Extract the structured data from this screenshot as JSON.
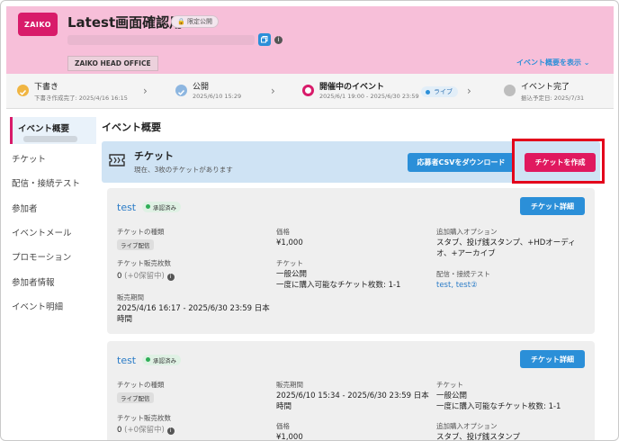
{
  "header": {
    "logo_text": "ZAIKO",
    "title": "Latest画面確認用",
    "limited_badge": "🔒 限定公開",
    "copy_icon": "copy-icon",
    "org_tag": "ZAIKO HEAD OFFICE",
    "show_summary": "イベント概要を表示 ⌄"
  },
  "steps": [
    {
      "label": "下書き",
      "sub": "下書き作成完了: 2025/4/16 16:15",
      "state": "done",
      "color": "#f0b542"
    },
    {
      "label": "公開",
      "sub": "2025/6/10 15:29",
      "state": "done",
      "color": "#8db6e0"
    },
    {
      "label": "開催中のイベント",
      "sub": "2025/6/1 19:00 - 2025/6/30 23:59",
      "state": "current",
      "color": "#d81b6a"
    },
    {
      "label": "イベント完了",
      "sub": "振込予定日: 2025/7/31",
      "state": "pending",
      "color": "#bdbdbd"
    }
  ],
  "live_badge": "ライブ",
  "sidebar": {
    "items": [
      "イベント概要",
      "チケット",
      "配信・接続テスト",
      "参加者",
      "イベントメール",
      "プロモーション",
      "参加者情報",
      "イベント明細"
    ]
  },
  "main": {
    "title": "イベント概要",
    "ticket_section": {
      "title": "チケット",
      "subtitle": "現在、3枚のチケットがあります",
      "download_button": "応募者CSVをダウンロード",
      "create_button": "チケットを作成"
    },
    "cards": [
      {
        "name": "test",
        "status": "承認済み",
        "detail_button": "チケット詳細",
        "type_label": "チケットの種類",
        "type_value": "ライブ配信",
        "sold_label": "チケット販売枚数",
        "sold_value": "0",
        "sold_hold": "(+0保留中)",
        "period_label": "販売期間",
        "period_value_1": "2025/4/16 16:17 - 2025/6/30 23:59 日本",
        "period_value_2": "時間",
        "price_label": "価格",
        "price_value": "¥1,000",
        "ticket_label": "チケット",
        "ticket_value_1": "一般公開",
        "ticket_value_2": "一度に購入可能なチケット枚数: 1-1",
        "addon_label": "追加購入オプション",
        "addon_value_1": "スタブ、投げ銭スタンプ、+HDオーディ",
        "addon_value_2": "オ、+アーカイブ",
        "stream_label": "配信・接続テスト",
        "stream_value": "test, test②"
      },
      {
        "name": "test",
        "status": "承認済み",
        "detail_button": "チケット詳細",
        "type_label": "チケットの種類",
        "type_value": "ライブ配信",
        "sold_label": "チケット販売枚数",
        "sold_value": "0",
        "sold_hold": "(+0保留中)",
        "period_label": "販売期間",
        "period_value_1": "2025/6/10 15:34 - 2025/6/30 23:59 日本",
        "period_value_2": "時間",
        "price_label": "価格",
        "price_value": "¥1,000",
        "ticket_label": "チケット",
        "ticket_value_1": "一般公開",
        "ticket_value_2": "一度に購入可能なチケット枚数: 1-1",
        "addon_label": "追加購入オプション",
        "addon_value_1": "スタブ、投げ銭スタンプ"
      }
    ]
  }
}
